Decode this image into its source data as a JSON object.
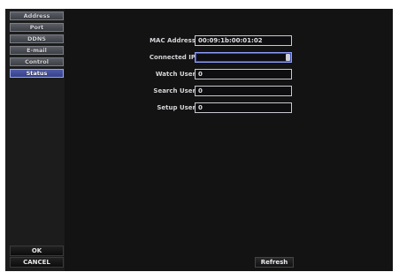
{
  "sidebar": {
    "items": [
      {
        "label": "Address"
      },
      {
        "label": "Port"
      },
      {
        "label": "DDNS"
      },
      {
        "label": "E-mail"
      },
      {
        "label": "Control"
      },
      {
        "label": "Status"
      }
    ],
    "active": "Status"
  },
  "form": {
    "mac_address": {
      "label": "MAC Address",
      "value": "00:09:1b:00:01:02"
    },
    "connected_ip": {
      "label": "Connected IP",
      "value": ""
    },
    "watch_user": {
      "label": "Watch User",
      "value": "0"
    },
    "search_user": {
      "label": "Search User",
      "value": "0"
    },
    "setup_user": {
      "label": "Setup User",
      "value": "0"
    }
  },
  "buttons": {
    "ok": "OK",
    "cancel": "CANCEL",
    "refresh": "Refresh"
  },
  "colors": {
    "active_tab": "#3f4a9a",
    "background": "#151515"
  }
}
